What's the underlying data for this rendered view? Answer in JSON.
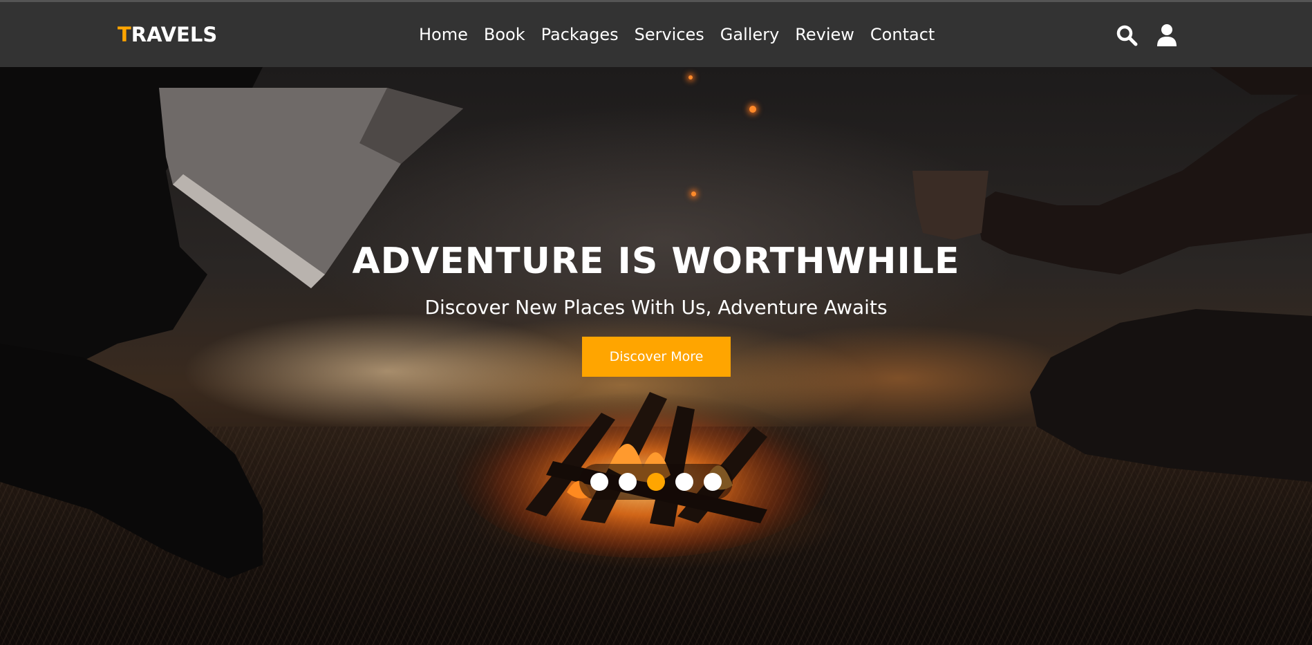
{
  "header": {
    "logo": {
      "accent_letter": "T",
      "rest": "RAVELS"
    },
    "nav": [
      {
        "label": "Home"
      },
      {
        "label": "Book"
      },
      {
        "label": "Packages"
      },
      {
        "label": "Services"
      },
      {
        "label": "Gallery"
      },
      {
        "label": "Review"
      },
      {
        "label": "Contact"
      }
    ],
    "icons": [
      "search-icon",
      "user-icon"
    ]
  },
  "hero": {
    "title": "ADVENTURE IS WORTHWHILE",
    "subtitle": "Discover New Places With Us, Adventure Awaits",
    "cta_label": "Discover More",
    "slider": {
      "total": 5,
      "active_index": 3
    }
  },
  "colors": {
    "accent": "#ffa500",
    "header_bg": "#333333",
    "text": "#ffffff"
  }
}
